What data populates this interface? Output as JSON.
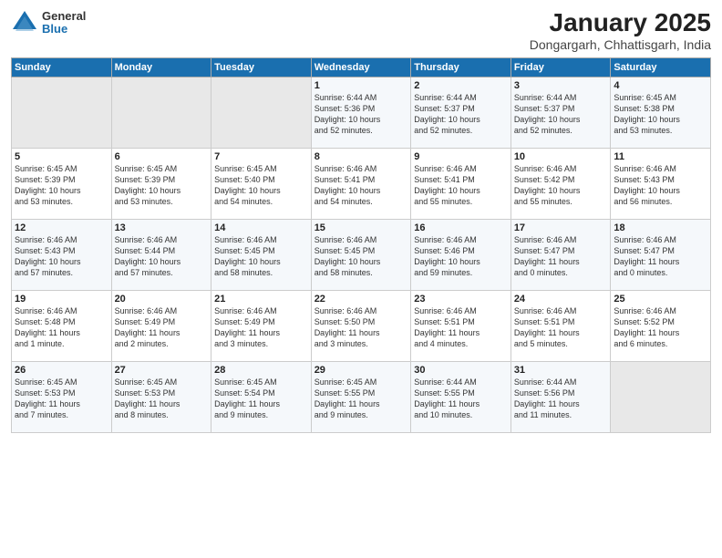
{
  "logo": {
    "general": "General",
    "blue": "Blue"
  },
  "header": {
    "title": "January 2025",
    "subtitle": "Dongargarh, Chhattisgarh, India"
  },
  "weekdays": [
    "Sunday",
    "Monday",
    "Tuesday",
    "Wednesday",
    "Thursday",
    "Friday",
    "Saturday"
  ],
  "weeks": [
    [
      {
        "day": "",
        "data": ""
      },
      {
        "day": "",
        "data": ""
      },
      {
        "day": "",
        "data": ""
      },
      {
        "day": "1",
        "data": "Sunrise: 6:44 AM\nSunset: 5:36 PM\nDaylight: 10 hours\nand 52 minutes."
      },
      {
        "day": "2",
        "data": "Sunrise: 6:44 AM\nSunset: 5:37 PM\nDaylight: 10 hours\nand 52 minutes."
      },
      {
        "day": "3",
        "data": "Sunrise: 6:44 AM\nSunset: 5:37 PM\nDaylight: 10 hours\nand 52 minutes."
      },
      {
        "day": "4",
        "data": "Sunrise: 6:45 AM\nSunset: 5:38 PM\nDaylight: 10 hours\nand 53 minutes."
      }
    ],
    [
      {
        "day": "5",
        "data": "Sunrise: 6:45 AM\nSunset: 5:39 PM\nDaylight: 10 hours\nand 53 minutes."
      },
      {
        "day": "6",
        "data": "Sunrise: 6:45 AM\nSunset: 5:39 PM\nDaylight: 10 hours\nand 53 minutes."
      },
      {
        "day": "7",
        "data": "Sunrise: 6:45 AM\nSunset: 5:40 PM\nDaylight: 10 hours\nand 54 minutes."
      },
      {
        "day": "8",
        "data": "Sunrise: 6:46 AM\nSunset: 5:41 PM\nDaylight: 10 hours\nand 54 minutes."
      },
      {
        "day": "9",
        "data": "Sunrise: 6:46 AM\nSunset: 5:41 PM\nDaylight: 10 hours\nand 55 minutes."
      },
      {
        "day": "10",
        "data": "Sunrise: 6:46 AM\nSunset: 5:42 PM\nDaylight: 10 hours\nand 55 minutes."
      },
      {
        "day": "11",
        "data": "Sunrise: 6:46 AM\nSunset: 5:43 PM\nDaylight: 10 hours\nand 56 minutes."
      }
    ],
    [
      {
        "day": "12",
        "data": "Sunrise: 6:46 AM\nSunset: 5:43 PM\nDaylight: 10 hours\nand 57 minutes."
      },
      {
        "day": "13",
        "data": "Sunrise: 6:46 AM\nSunset: 5:44 PM\nDaylight: 10 hours\nand 57 minutes."
      },
      {
        "day": "14",
        "data": "Sunrise: 6:46 AM\nSunset: 5:45 PM\nDaylight: 10 hours\nand 58 minutes."
      },
      {
        "day": "15",
        "data": "Sunrise: 6:46 AM\nSunset: 5:45 PM\nDaylight: 10 hours\nand 58 minutes."
      },
      {
        "day": "16",
        "data": "Sunrise: 6:46 AM\nSunset: 5:46 PM\nDaylight: 10 hours\nand 59 minutes."
      },
      {
        "day": "17",
        "data": "Sunrise: 6:46 AM\nSunset: 5:47 PM\nDaylight: 11 hours\nand 0 minutes."
      },
      {
        "day": "18",
        "data": "Sunrise: 6:46 AM\nSunset: 5:47 PM\nDaylight: 11 hours\nand 0 minutes."
      }
    ],
    [
      {
        "day": "19",
        "data": "Sunrise: 6:46 AM\nSunset: 5:48 PM\nDaylight: 11 hours\nand 1 minute."
      },
      {
        "day": "20",
        "data": "Sunrise: 6:46 AM\nSunset: 5:49 PM\nDaylight: 11 hours\nand 2 minutes."
      },
      {
        "day": "21",
        "data": "Sunrise: 6:46 AM\nSunset: 5:49 PM\nDaylight: 11 hours\nand 3 minutes."
      },
      {
        "day": "22",
        "data": "Sunrise: 6:46 AM\nSunset: 5:50 PM\nDaylight: 11 hours\nand 3 minutes."
      },
      {
        "day": "23",
        "data": "Sunrise: 6:46 AM\nSunset: 5:51 PM\nDaylight: 11 hours\nand 4 minutes."
      },
      {
        "day": "24",
        "data": "Sunrise: 6:46 AM\nSunset: 5:51 PM\nDaylight: 11 hours\nand 5 minutes."
      },
      {
        "day": "25",
        "data": "Sunrise: 6:46 AM\nSunset: 5:52 PM\nDaylight: 11 hours\nand 6 minutes."
      }
    ],
    [
      {
        "day": "26",
        "data": "Sunrise: 6:45 AM\nSunset: 5:53 PM\nDaylight: 11 hours\nand 7 minutes."
      },
      {
        "day": "27",
        "data": "Sunrise: 6:45 AM\nSunset: 5:53 PM\nDaylight: 11 hours\nand 8 minutes."
      },
      {
        "day": "28",
        "data": "Sunrise: 6:45 AM\nSunset: 5:54 PM\nDaylight: 11 hours\nand 9 minutes."
      },
      {
        "day": "29",
        "data": "Sunrise: 6:45 AM\nSunset: 5:55 PM\nDaylight: 11 hours\nand 9 minutes."
      },
      {
        "day": "30",
        "data": "Sunrise: 6:44 AM\nSunset: 5:55 PM\nDaylight: 11 hours\nand 10 minutes."
      },
      {
        "day": "31",
        "data": "Sunrise: 6:44 AM\nSunset: 5:56 PM\nDaylight: 11 hours\nand 11 minutes."
      },
      {
        "day": "",
        "data": ""
      }
    ]
  ]
}
